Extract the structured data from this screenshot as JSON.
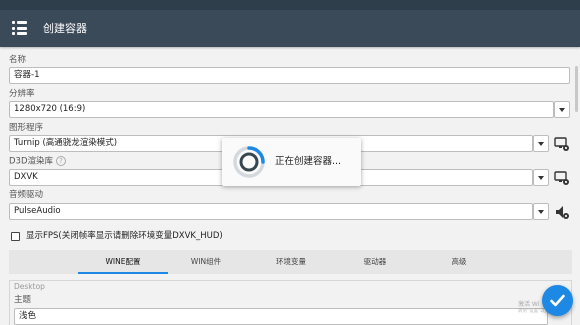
{
  "appbar": {
    "title": "创建容器",
    "menu_icon": "hamburger-menu-icon"
  },
  "form": {
    "name": {
      "label": "名称",
      "value": "容器-1"
    },
    "resolution": {
      "label": "分辨率",
      "value": "1280x720 (16:9)"
    },
    "graphics": {
      "label": "图形程序",
      "value": "Turnip (高通骁龙渲染模式)"
    },
    "d3d": {
      "label": "D3D渲染库",
      "value": "DXVK",
      "help": "?"
    },
    "audio": {
      "label": "音频驱动",
      "value": "PulseAudio"
    },
    "fps": {
      "label": "显示FPS(关闭帧率显示请删除环境变量DXVK_HUD)",
      "checked": false
    }
  },
  "tabs": [
    {
      "label": "WINE配置",
      "active": true
    },
    {
      "label": "WIN组件",
      "active": false
    },
    {
      "label": "环境变量",
      "active": false
    },
    {
      "label": "驱动器",
      "active": false
    },
    {
      "label": "高级",
      "active": false
    }
  ],
  "desktop": {
    "section_title": "Desktop",
    "theme_label": "主题",
    "theme_value": "浅色"
  },
  "dialog": {
    "message": "正在创建容器..."
  },
  "watermark": {
    "line1": "激活 Wi",
    "line2": "转到\"设置\"以激活 Wi"
  },
  "colors": {
    "appbar": "#3b4a59",
    "accent": "#1e88e5",
    "background": "#f2f2f2"
  }
}
